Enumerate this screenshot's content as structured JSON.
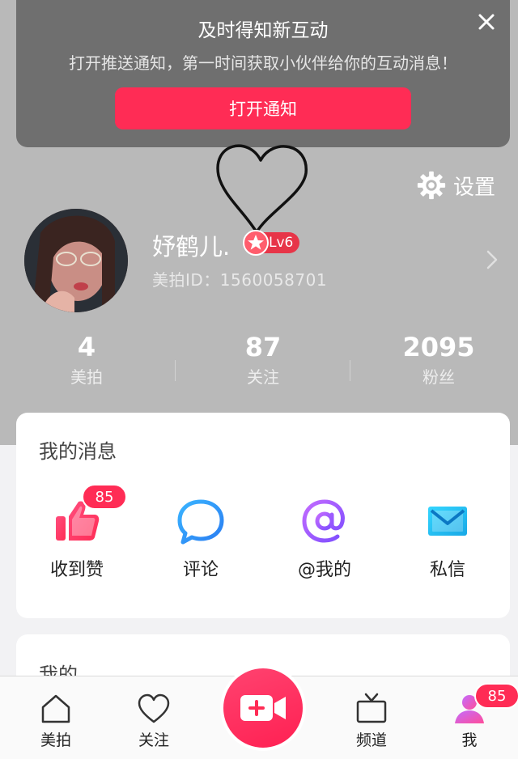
{
  "notification": {
    "title": "及时得知新互动",
    "description": "打开推送通知，第一时间获取小伙伴给你的互动消息！",
    "button_label": "打开通知"
  },
  "settings": {
    "label": "设置"
  },
  "profile": {
    "name": "妤鹤儿.",
    "level": "Lv6",
    "id_label": "美拍ID：1560058701"
  },
  "stats": [
    {
      "value": "4",
      "label": "美拍"
    },
    {
      "value": "87",
      "label": "关注"
    },
    {
      "value": "2095",
      "label": "粉丝"
    }
  ],
  "messages": {
    "title": "我的消息",
    "items": [
      {
        "label": "收到赞",
        "badge": "85",
        "icon": "thumbs-up-icon"
      },
      {
        "label": "评论",
        "icon": "comment-bubble-icon"
      },
      {
        "label": "@我的",
        "icon": "at-sign-icon"
      },
      {
        "label": "私信",
        "icon": "envelope-icon"
      }
    ]
  },
  "mine": {
    "title": "我的"
  },
  "nav": {
    "items": [
      {
        "label": "美拍",
        "icon": "home-icon"
      },
      {
        "label": "关注",
        "icon": "heart-icon"
      },
      {
        "label": "频道",
        "icon": "tv-icon"
      },
      {
        "label": "我",
        "icon": "profile-icon",
        "badge": "85"
      }
    ],
    "record_icon": "video-camera-plus-icon"
  },
  "colors": {
    "accent": "#ff2c55",
    "header_bg": "#b9b9b9",
    "banner_bg": "#6f6f6f",
    "level_badge": "#e73548"
  }
}
